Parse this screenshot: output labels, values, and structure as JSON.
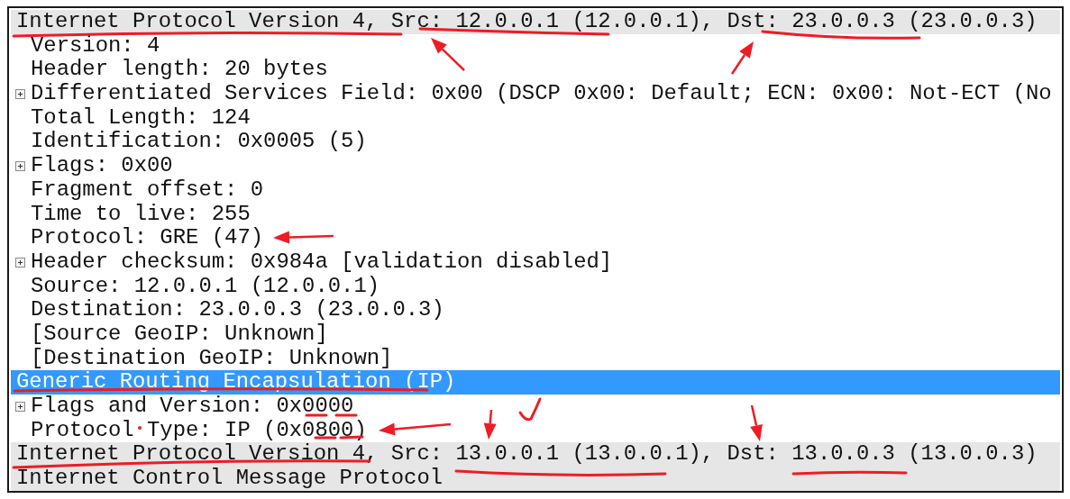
{
  "protocols": [
    {
      "label": "Internet Protocol Version 4, Src: 12.0.0.1 (12.0.0.1), Dst: 23.0.0.3 (23.0.0.3)",
      "selected": false,
      "children": [
        {
          "label": "Version: 4",
          "has_children": false
        },
        {
          "label": "Header length: 20 bytes",
          "has_children": false
        },
        {
          "label": "Differentiated Services Field: 0x00 (DSCP 0x00: Default; ECN: 0x00: Not-ECT (No",
          "has_children": true
        },
        {
          "label": "Total Length: 124",
          "has_children": false
        },
        {
          "label": "Identification: 0x0005 (5)",
          "has_children": false
        },
        {
          "label": "Flags: 0x00",
          "has_children": true
        },
        {
          "label": "Fragment offset: 0",
          "has_children": false
        },
        {
          "label": "Time to live: 255",
          "has_children": false
        },
        {
          "label": "Protocol: GRE (47)",
          "has_children": false
        },
        {
          "label": "Header checksum: 0x984a [validation disabled]",
          "has_children": true
        },
        {
          "label": "Source: 12.0.0.1 (12.0.0.1)",
          "has_children": false
        },
        {
          "label": "Destination: 23.0.0.3 (23.0.0.3)",
          "has_children": false
        },
        {
          "label": "[Source GeoIP: Unknown]",
          "has_children": false
        },
        {
          "label": "[Destination GeoIP: Unknown]",
          "has_children": false
        }
      ]
    },
    {
      "label": "Generic Routing Encapsulation (IP)",
      "selected": true,
      "children": [
        {
          "label": "Flags and Version: 0x0000",
          "has_children": true
        },
        {
          "label": "Protocol Type: IP (0x0800)",
          "has_children": false
        }
      ]
    },
    {
      "label": "Internet Protocol Version 4, Src: 13.0.0.1 (13.0.0.1), Dst: 13.0.0.3 (13.0.0.3)",
      "selected": false
    },
    {
      "label": "Internet Control Message Protocol",
      "selected": false
    }
  ]
}
